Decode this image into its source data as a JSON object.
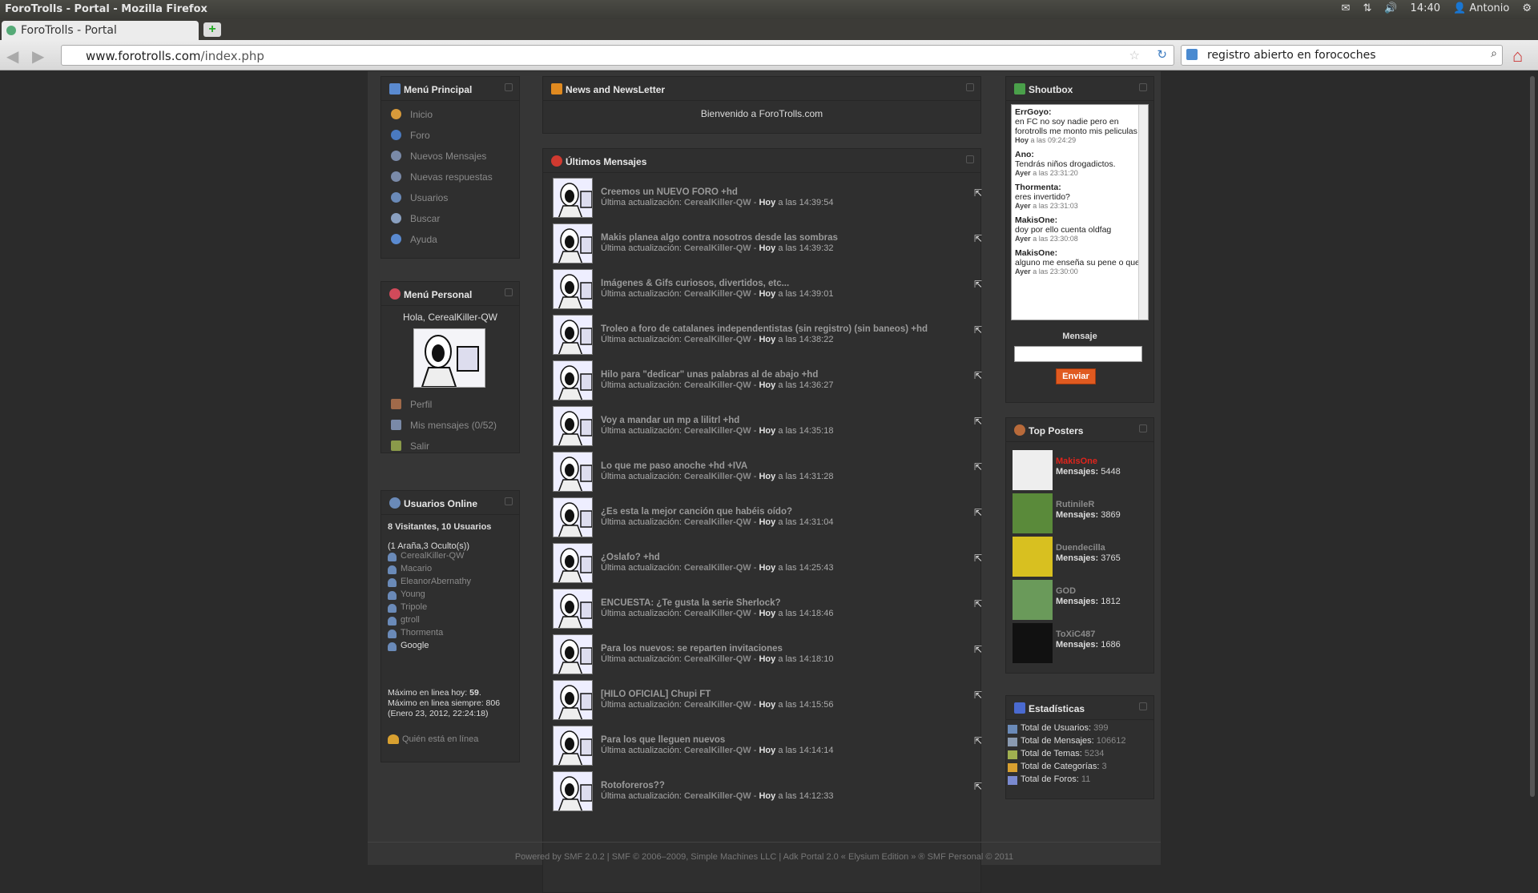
{
  "window_title": "ForoTrolls - Portal - Mozilla Firefox",
  "tray": {
    "time": "14:40",
    "user": "Antonio"
  },
  "tab": {
    "label": "ForoTrolls - Portal",
    "new_tab": "+"
  },
  "nav": {
    "url_domain": "www.forotrolls.com",
    "url_path": "/index.php",
    "search_value": "registro abierto en forocoches"
  },
  "menu_principal": {
    "title": "Menú Principal",
    "items": [
      {
        "label": "Inicio",
        "icon": "home-icon",
        "color": "#d89a3a"
      },
      {
        "label": "Foro",
        "icon": "info-icon",
        "color": "#4a7ac0"
      },
      {
        "label": "Nuevos Mensajes",
        "icon": "mail-icon",
        "color": "#7a8aa8"
      },
      {
        "label": "Nuevas respuestas",
        "icon": "replies-icon",
        "color": "#7a8aa8"
      },
      {
        "label": "Usuarios",
        "icon": "users-icon",
        "color": "#6a8ab8"
      },
      {
        "label": "Buscar",
        "icon": "search-icon",
        "color": "#8aa0c0"
      },
      {
        "label": "Ayuda",
        "icon": "help-icon",
        "color": "#5a8ad0"
      }
    ]
  },
  "menu_personal": {
    "title": "Menú Personal",
    "greeting": "Hola, CerealKiller-QW",
    "items": [
      {
        "label": "Perfil",
        "icon": "profile-icon",
        "color": "#a06a4a"
      },
      {
        "label": "Mis mensajes (0/52)",
        "icon": "messages-icon",
        "color": "#7a8aa8"
      },
      {
        "label": "Salir",
        "icon": "exit-icon",
        "color": "#8a9a4a"
      }
    ]
  },
  "usuarios_online": {
    "title": "Usuarios Online",
    "summary": "8 Visitantes, 10 Usuarios",
    "hidden": "(1 Araña,3 Oculto(s))",
    "users": [
      "CerealKiller-QW",
      "Macario",
      "EleanorAbernathy",
      "Young",
      "Tripole",
      "gtroll",
      "Thormenta",
      "Google"
    ],
    "max_today_label": "Máximo en linea hoy:",
    "max_today": "59",
    "max_ever": "Máximo en linea siempre: 806",
    "max_ever_date": "(Enero 23, 2012, 22:24:18)",
    "who_online": "Quién está en línea"
  },
  "news": {
    "title": "News and NewsLetter",
    "welcome": "Bienvenido a ForoTrolls.com"
  },
  "ultimos": {
    "title": "Últimos Mensajes",
    "update_label": "Última actualización:",
    "today_label": "Hoy",
    "at_label": "a las",
    "messages": [
      {
        "title": "Creemos un NUEVO FORO +hd",
        "user": "CerealKiller-QW",
        "time": "14:39:54"
      },
      {
        "title": "Makis planea algo contra nosotros desde las sombras",
        "user": "CerealKiller-QW",
        "time": "14:39:32"
      },
      {
        "title": "Imágenes & Gifs curiosos, divertidos, etc...",
        "user": "CerealKiller-QW",
        "time": "14:39:01"
      },
      {
        "title": "Troleo a foro de catalanes independentistas (sin registro) (sin baneos) +hd",
        "user": "CerealKiller-QW",
        "time": "14:38:22"
      },
      {
        "title": "Hilo para \"dedicar\" unas palabras al de abajo +hd",
        "user": "CerealKiller-QW",
        "time": "14:36:27"
      },
      {
        "title": "Voy a mandar un mp a lilitrl +hd",
        "user": "CerealKiller-QW",
        "time": "14:35:18"
      },
      {
        "title": "Lo que me paso anoche +hd +IVA",
        "user": "CerealKiller-QW",
        "time": "14:31:28"
      },
      {
        "title": "¿Es esta la mejor canción que habéis oído?",
        "user": "CerealKiller-QW",
        "time": "14:31:04"
      },
      {
        "title": "¿Oslafo? +hd",
        "user": "CerealKiller-QW",
        "time": "14:25:43"
      },
      {
        "title": "ENCUESTA: ¿Te gusta la serie Sherlock?",
        "user": "CerealKiller-QW",
        "time": "14:18:46"
      },
      {
        "title": "Para los nuevos: se reparten invitaciones",
        "user": "CerealKiller-QW",
        "time": "14:18:10"
      },
      {
        "title": "[HILO OFICIAL] Chupi FT",
        "user": "CerealKiller-QW",
        "time": "14:15:56"
      },
      {
        "title": "Para los que lleguen nuevos",
        "user": "CerealKiller-QW",
        "time": "14:14:14"
      },
      {
        "title": "Rotoforeros??",
        "user": "CerealKiller-QW",
        "time": "14:12:33"
      }
    ]
  },
  "shoutbox": {
    "title": "Shoutbox",
    "entries": [
      {
        "name": "ErrGoyo:",
        "text": "en FC no soy nadie pero en forotrolls me monto mis peliculas",
        "day": "Hoy",
        "time": "a las 09:24:29"
      },
      {
        "name": "Ano:",
        "text": "Tendrás niños drogadictos.",
        "day": "Ayer",
        "time": "a las 23:31:20"
      },
      {
        "name": "Thormenta:",
        "text": "eres invertido?",
        "day": "Ayer",
        "time": "a las 23:31:03"
      },
      {
        "name": "MakisOne:",
        "text": "doy por ello cuenta oldfag",
        "day": "Ayer",
        "time": "a las 23:30:08"
      },
      {
        "name": "MakisOne:",
        "text": "alguno me enseña su pene o que",
        "day": "Ayer",
        "time": "a las 23:30:00"
      }
    ],
    "message_label": "Mensaje",
    "send": "Enviar"
  },
  "top_posters": {
    "title": "Top Posters",
    "label": "Mensajes:",
    "posters": [
      {
        "name": "MakisOne",
        "count": "5448",
        "color": "#e0241c"
      },
      {
        "name": "RutinileR",
        "count": "3869",
        "color": "#8a8a8a"
      },
      {
        "name": "Duendecilla",
        "count": "3765",
        "color": "#8a8a8a"
      },
      {
        "name": "GOD",
        "count": "1812",
        "color": "#8a8a8a"
      },
      {
        "name": "ToXiC487",
        "count": "1686",
        "color": "#8a8a8a"
      }
    ]
  },
  "estadisticas": {
    "title": "Estadísticas",
    "items": [
      {
        "label": "Total de Usuarios:",
        "value": "399",
        "icon": "users-icon"
      },
      {
        "label": "Total de Mensajes:",
        "value": "106612",
        "icon": "messages-icon"
      },
      {
        "label": "Total de Temas:",
        "value": "5234",
        "icon": "topics-icon"
      },
      {
        "label": "Total de Categorías:",
        "value": "3",
        "icon": "categories-icon"
      },
      {
        "label": "Total de Foros:",
        "value": "11",
        "icon": "forums-icon"
      }
    ]
  },
  "footer": "Powered by SMF 2.0.2 | SMF © 2006–2009, Simple Machines LLC | Adk Portal 2.0 « Elysium Edition » ® SMF Personal © 2011"
}
